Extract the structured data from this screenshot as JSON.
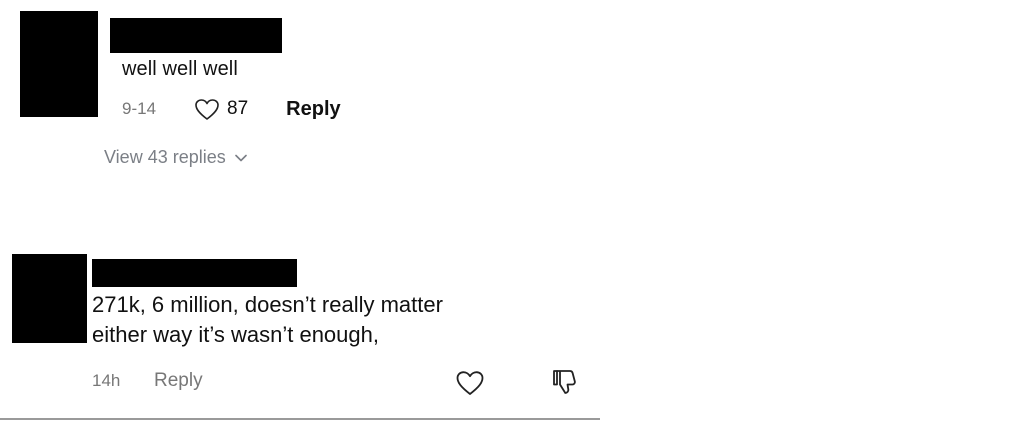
{
  "comments": [
    {
      "text": "well well well",
      "date": "9-14",
      "like_count": "87",
      "reply_label": "Reply",
      "view_replies_label": "View 43 replies",
      "icons": {
        "like": "heart-outline-icon",
        "expand": "chevron-down-icon"
      }
    },
    {
      "text_lines": [
        "271k, 6 million, doesn’t really matter",
        "either way it’s wasn’t enough,"
      ],
      "time": "14h",
      "reply_label": "Reply",
      "icons": {
        "like": "heart-outline-icon",
        "dislike": "thumbs-down-icon"
      }
    }
  ],
  "colors": {
    "text": "#111111",
    "muted": "#777777",
    "link_muted": "#7b7f86",
    "redaction": "#000000",
    "divider": "#9a9a9a"
  }
}
